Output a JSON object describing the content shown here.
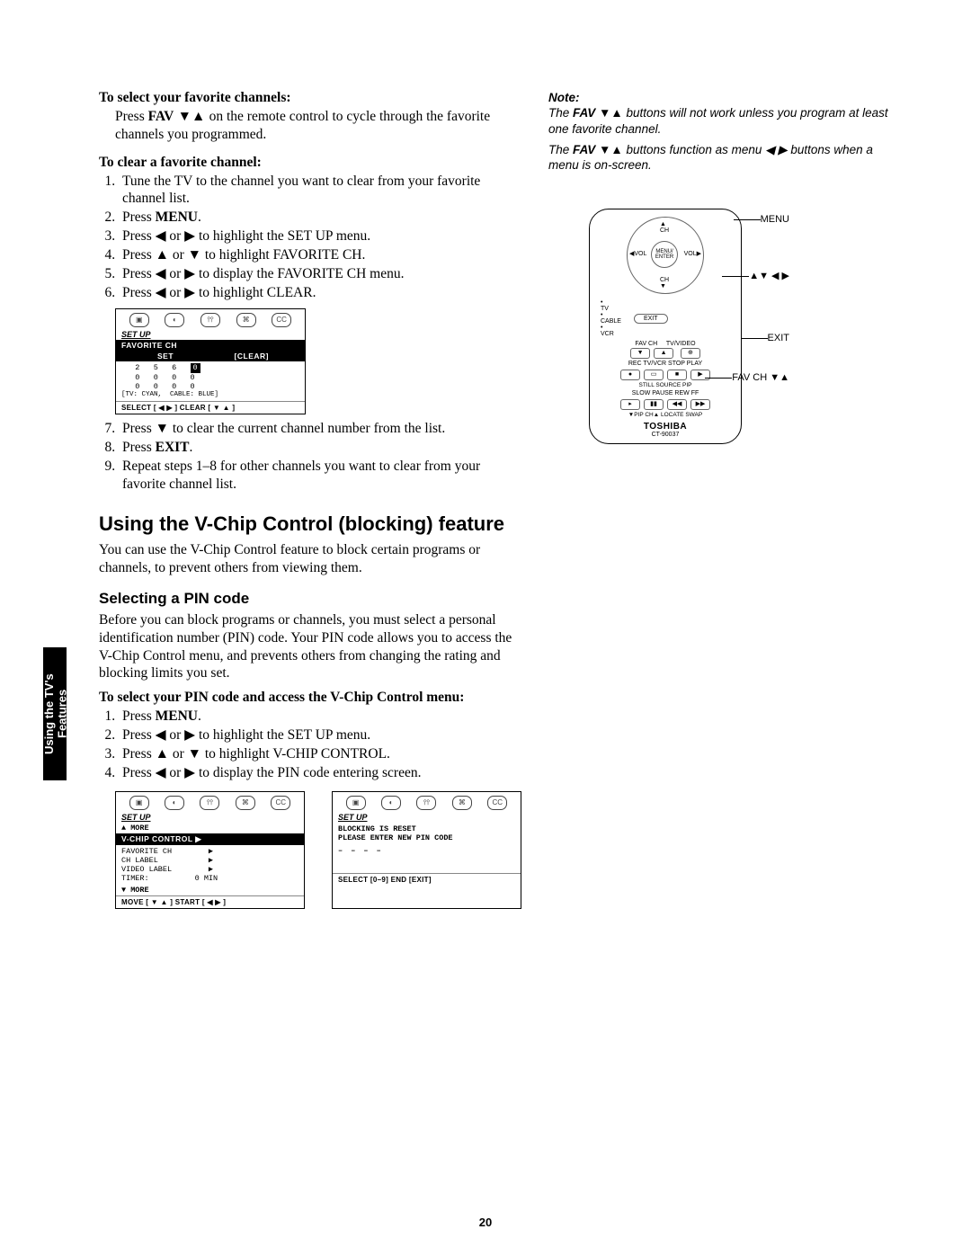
{
  "page_number": "20",
  "side_tab": "Using the TV's\nFeatures",
  "headings": {
    "select_fav": "To select your favorite channels:",
    "clear_fav": "To clear a favorite channel:",
    "vchip_title": "Using the V-Chip Control (blocking) feature",
    "select_pin": "Selecting a PIN code",
    "pin_steps_title": "To select your PIN code and access the V-Chip Control menu:"
  },
  "select_fav_text": {
    "prefix": "Press ",
    "fav": "FAV",
    "arrows": " ▼▲ ",
    "rest": "on the remote control to cycle through the favorite channels you programmed."
  },
  "clear_steps": [
    "Tune the TV to the channel you want to clear from your favorite channel list.",
    "Press MENU.",
    "Press ◀ or ▶ to highlight the SET UP menu.",
    "Press ▲ or ▼ to highlight FAVORITE CH.",
    "Press ◀ or ▶ to display the FAVORITE CH menu.",
    "Press ◀ or ▶ to highlight CLEAR."
  ],
  "clear_steps_after": [
    "Press ▼ to clear the current channel number from the list.",
    "Press EXIT.",
    "Repeat steps 1–8 for other channels you want to clear from your favorite channel list."
  ],
  "vchip_intro": "You can use the V-Chip Control feature to block certain programs or channels, to prevent others from viewing them.",
  "pin_intro": "Before you can block programs or channels, you must select a personal identification number (PIN) code. Your PIN code allows you to access the V-Chip Control menu, and prevents others from changing the rating and blocking limits you set.",
  "pin_steps": [
    "Press MENU.",
    "Press ◀ or ▶ to highlight the SET UP menu.",
    "Press ▲ or ▼ to highlight V-CHIP CONTROL.",
    "Press ◀ or ▶ to display the PIN code entering screen."
  ],
  "note": {
    "title": "Note:",
    "line1a": "The ",
    "line1b": "FAV",
    "line1c": " ▼▲ buttons will not work unless you program at least one favorite channel.",
    "line2a": "The ",
    "line2b": "FAV",
    "line2c": " ▼▲ buttons function as menu ◀ ▶ buttons when a menu is on-screen."
  },
  "osd1": {
    "title": "SET UP",
    "hl1": "FAVORITE CH",
    "hl2_left": "SET",
    "hl2_right": "[CLEAR]",
    "rows": [
      "   2   5   6   0",
      "   0   0   0   0",
      "   0   0   0   0"
    ],
    "caption": "[TV: CYAN,  CABLE: BLUE]",
    "footer": "SELECT [ ◀ ▶ ]    CLEAR [ ▼ ▲ ]"
  },
  "osd2": {
    "title": "SET UP",
    "more_up": "▲ MORE",
    "hl": "V-CHIP CONTROL     ▶",
    "rows": [
      "FAVORITE CH        ▶",
      "CH LABEL           ▶",
      "VIDEO LABEL        ▶",
      "TIMER:          0 MIN"
    ],
    "more_down": "▼ MORE",
    "footer": "MOVE [ ▼ ▲ ]     START [ ◀  ▶ ]"
  },
  "osd3": {
    "title": "SET UP",
    "line1": "BLOCKING IS RESET",
    "line2": "PLEASE ENTER NEW PIN CODE",
    "dashes": "– – – –",
    "footer": "SELECT [0–9]   END [EXIT]"
  },
  "remote": {
    "menu": "MENU",
    "arrows": "▲▼ ◀ ▶",
    "exit": "EXIT",
    "favch": "FAV CH ▼▲",
    "center": "MENU/\nENTER",
    "ch": "CH",
    "vol": "VOL",
    "tv": "TV",
    "cable": "CABLE",
    "vcr": "VCR",
    "exit_btn": "EXIT",
    "favch_lbl": "FAV CH",
    "tvvideo": "TV/VIDEO",
    "row1_labels": "REC   TV/VCR   STOP   PLAY",
    "row1_icons": "●      ▭       ■      ▶",
    "row2_labels": "SLOW  PAUSE   REW    FF",
    "row2_icons": "▸     ▮▮     ◀◀    ▶▶",
    "row3_labels": "STILL  SOURCE  PIP",
    "row4": "▼PIP CH▲   LOCATE  SWAP",
    "brand": "TOSHIBA",
    "model": "CT-90037"
  }
}
